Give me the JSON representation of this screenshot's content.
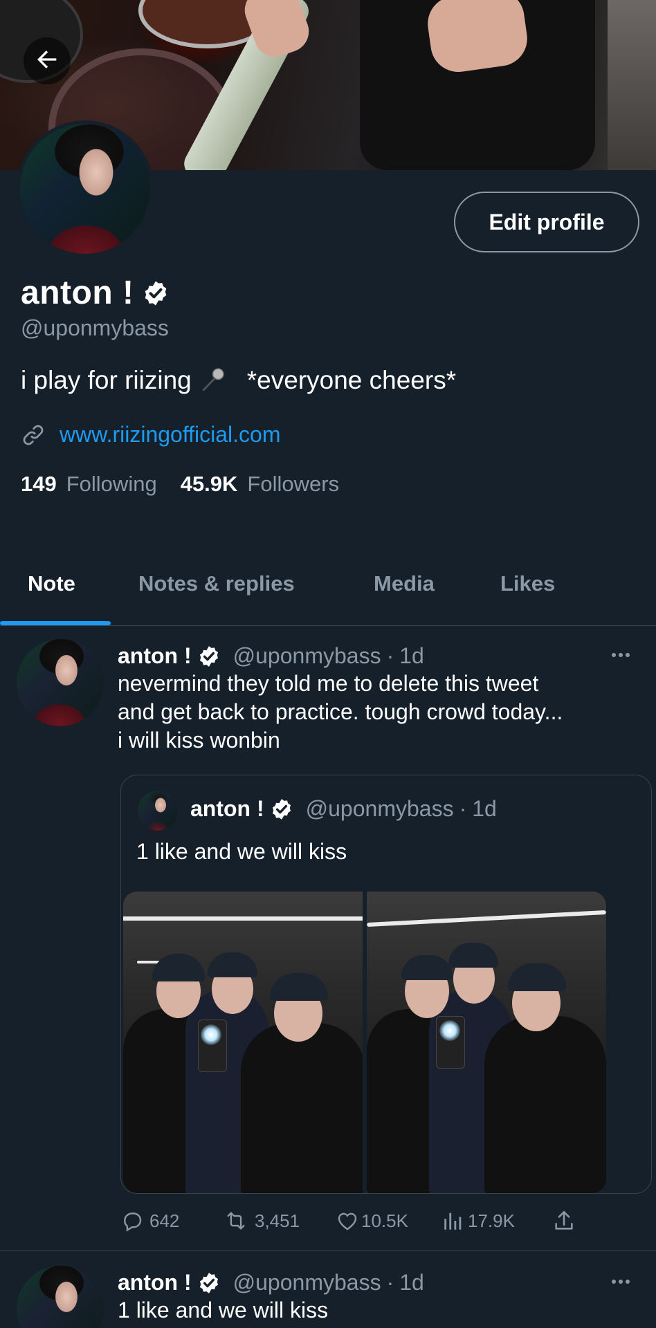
{
  "profile": {
    "display_name": "anton !",
    "handle": "@uponmybass",
    "bio_part1": "i play for riizing",
    "bio_part2": "*everyone cheers*",
    "website": "www.riizingofficial.com",
    "following_count": "149",
    "following_label": "Following",
    "followers_count": "45.9K",
    "followers_label": "Followers",
    "edit_profile_label": "Edit profile"
  },
  "tabs": [
    {
      "label": "Note",
      "active": true
    },
    {
      "label": "Notes & replies",
      "active": false
    },
    {
      "label": "Media",
      "active": false
    },
    {
      "label": "Likes",
      "active": false
    }
  ],
  "tweets": [
    {
      "name": "anton !",
      "handle": "@uponmybass",
      "separator": "·",
      "time": "1d",
      "text_lines": [
        "nevermind they told me to delete this tweet",
        "and get back to practice. tough crowd today...",
        "i will kiss wonbin"
      ],
      "quote": {
        "name": "anton !",
        "handle": "@uponmybass",
        "separator": "·",
        "time": "1d",
        "text": "1 like and we will kiss"
      },
      "stats": {
        "replies": "642",
        "retweets": "3,451",
        "likes": "10.5K",
        "views": "17.9K"
      }
    },
    {
      "name": "anton !",
      "handle": "@uponmybass",
      "separator": "·",
      "time": "1d",
      "text": "1 like and we will kiss"
    }
  ],
  "colors": {
    "background": "#15202b",
    "accent": "#1d9bf0",
    "secondary_text": "#8b98a5",
    "divider": "#38444d"
  },
  "icons": [
    "back-arrow-icon",
    "verified-badge-icon",
    "microphone-icon",
    "link-icon",
    "more-icon",
    "reply-icon",
    "retweet-icon",
    "like-icon",
    "views-icon",
    "share-icon"
  ]
}
